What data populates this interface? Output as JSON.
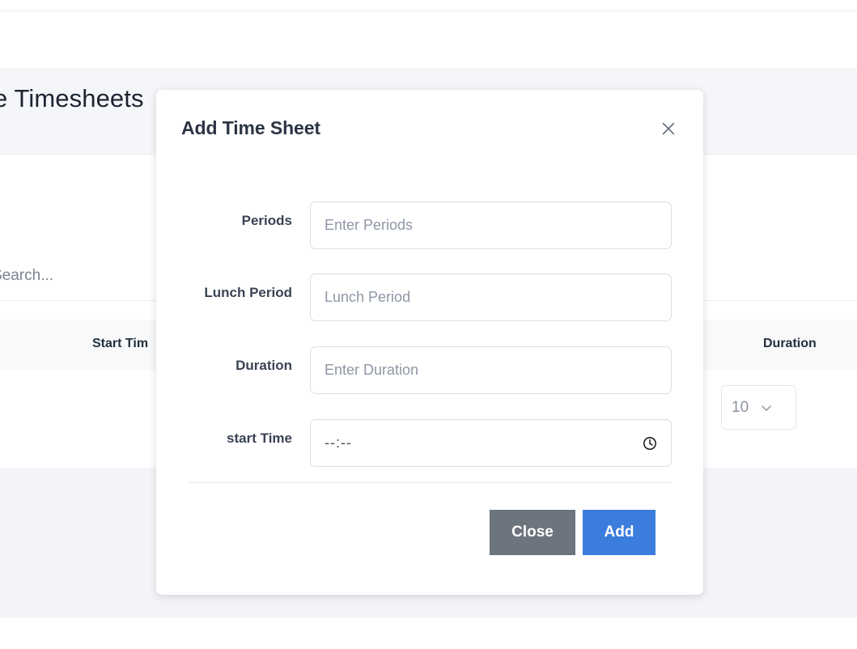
{
  "background": {
    "page_title": "e Timesheets",
    "search_placeholder": "Search...",
    "table_headers": {
      "start_time": "Start Tim",
      "duration": "Duration"
    },
    "page_size_value": "10",
    "chevron_icon": "chevron-down-icon"
  },
  "modal": {
    "title": "Add Time Sheet",
    "close_icon": "close-icon",
    "fields": [
      {
        "label": "Periods",
        "placeholder": "Enter Periods",
        "value": ""
      },
      {
        "label": "Lunch Period",
        "placeholder": "Lunch Period",
        "value": ""
      },
      {
        "label": "Duration",
        "placeholder": "Enter Duration",
        "value": ""
      },
      {
        "label": "start Time",
        "placeholder": "--:--",
        "value": "--:--",
        "icon": "clock-icon"
      }
    ],
    "footer": {
      "close_label": "Close",
      "add_label": "Add"
    }
  },
  "colors": {
    "primary": "#3b7ddd",
    "secondary": "#6c757d",
    "page_bg": "#f2f4f8",
    "header_bg": "#f5f6fa",
    "text_dark": "#2c3445",
    "placeholder": "#8e97a4"
  }
}
